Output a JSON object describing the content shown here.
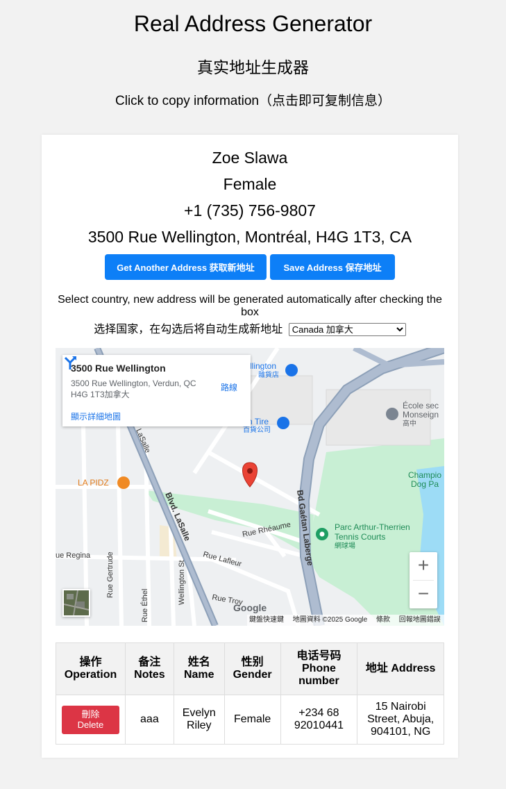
{
  "header": {
    "title": "Real Address Generator",
    "subtitle": "真实地址生成器",
    "instruction": "Click to copy information（点击即可复制信息）"
  },
  "person": {
    "name": "Zoe Slawa",
    "gender": "Female",
    "phone": "+1 (735) 756-9807",
    "address": "3500 Rue Wellington, Montréal, H4G 1T3, CA"
  },
  "buttons": {
    "get_another": "Get Another Address 获取新地址",
    "save": "Save Address 保存地址"
  },
  "country_select": {
    "note_en": "Select country, new address will be generated automatically after checking the box",
    "note_zh": "选择国家，在勾选后将自动生成新地址",
    "selected": "Canada 加拿大"
  },
  "map": {
    "infobox": {
      "title": "3500 Rue Wellington",
      "address_line1": "3500 Rue Wellington, Verdun, QC",
      "address_line2": "H4G 1T3加拿大",
      "directions": "路線",
      "more_link": "顯示詳細地圖"
    },
    "labels": {
      "wellington_store": "llington",
      "wellington_store_zh": "雜貨店",
      "tire": "n Tire",
      "tire_zh": "百貨公司",
      "ecole1": "École sec",
      "ecole2": "Monseign",
      "ecole_zh": "高中",
      "champ1": "Champio",
      "champ2": "Dog Pa",
      "la_pidz": "LA PIDZ",
      "lasalle_top": "LaSalle",
      "blvd_lasalle": "Blvd. LaSalle",
      "gaetan": "Bd Gaétan Laberge",
      "rheaume": "Rue Rhéaume",
      "lafleur": "Rue Lafleur",
      "regina": "ue Regina",
      "gertrude": "Rue Gertrude",
      "ethel": "Rue Éthel",
      "wellington_st": "Wellington St",
      "troy": "Rue Troy",
      "parc1": "Parc Arthur-Therrien",
      "parc2": "Tennis Courts",
      "parc_zh": "網球場"
    },
    "zoom_in": "+",
    "zoom_out": "−",
    "google": "Google",
    "attribution": {
      "shortcuts": "鍵盤快速鍵",
      "data": "地圖資料 ©2025 Google",
      "terms": "條款",
      "report": "回報地圖錯誤"
    }
  },
  "history_table": {
    "headers": [
      {
        "zh": "操作",
        "en": "Operation"
      },
      {
        "zh": "备注",
        "en": "Notes"
      },
      {
        "zh": "姓名",
        "en": "Name"
      },
      {
        "zh": "性别",
        "en": "Gender"
      },
      {
        "zh": "电话号码",
        "en": "Phone number"
      },
      {
        "zh": "地址",
        "en": "Address"
      }
    ],
    "rows": [
      {
        "delete_zh": "刪除",
        "delete_en": "Delete",
        "notes": "aaa",
        "name": "Evelyn Riley",
        "gender": "Female",
        "phone": "+234 68 92010441",
        "address": "15 Nairobi Street, Abuja, 904101, NG"
      }
    ]
  },
  "colors": {
    "primary_button": "#0d7ff7",
    "delete_button": "#dc3545",
    "park_green": "#c8efd4",
    "water_blue": "#9ddcf6",
    "highway": "#8da0b8"
  }
}
